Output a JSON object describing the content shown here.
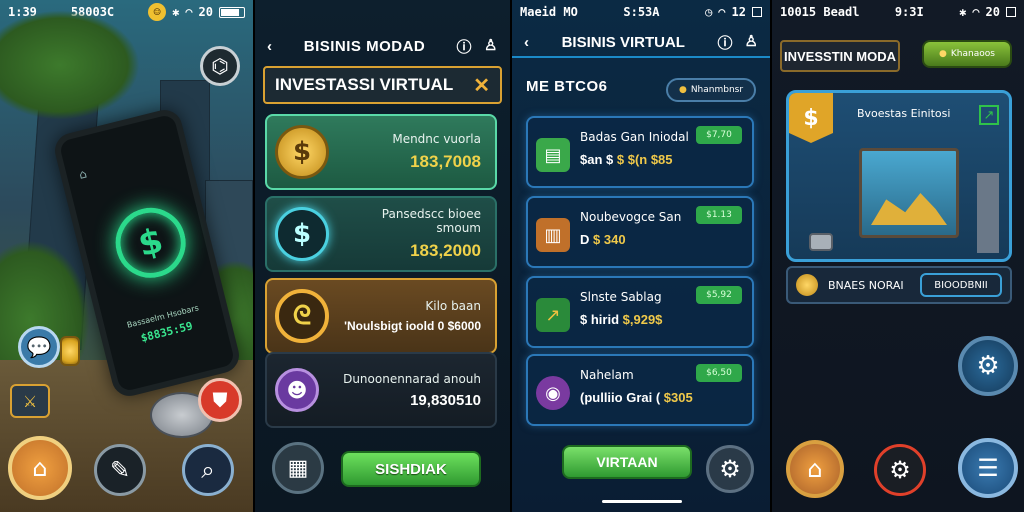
{
  "panel1": {
    "status": {
      "time": "1:39",
      "carrier": "58003C",
      "battery": "20"
    },
    "phone_screen": {
      "line1": "Bassaelm Hsobars",
      "amount": "$8835:59"
    },
    "icons": {
      "top_right": "lock-icon",
      "home": "home-icon",
      "tools": "tools-icon",
      "search": "search-icon",
      "chat": "chat-icon",
      "sword": "sword-icon",
      "shield": "shield-icon"
    }
  },
  "panel2": {
    "header": {
      "title": "BISINIS MODAD"
    },
    "title_box": {
      "label": "INVESTASSI VIRTUAL"
    },
    "cards": [
      {
        "name": "Mendnc vuorla",
        "value": "183,7008"
      },
      {
        "name": "Pansedscc bioee smoum",
        "value": "183,2000"
      },
      {
        "name": "Kilo baan",
        "value": "'Noulsbigt ioold 0 $6000"
      },
      {
        "name": "Dunoonennarad anouh",
        "value": "19,830510"
      }
    ],
    "main_button": "SISHDIAK"
  },
  "panel3": {
    "status": {
      "carrier": "Maeid",
      "network": "MO",
      "clock": "S:53A",
      "battery": "12"
    },
    "header": {
      "title": "BISINIS VIRTUAL"
    },
    "subtitle": "ME BTCO6",
    "pill": "Nhanmbnsr",
    "cards": [
      {
        "name": "Badas Gan Iniodal",
        "value_prefix": "$an $",
        "value": "$ $(n $85",
        "tag": "$7,70"
      },
      {
        "name": "Noubevogce San",
        "value_prefix": "D",
        "value": "$ 340",
        "tag": "$1.13"
      },
      {
        "name": "Slnste Sablag",
        "value_prefix": "$ hirid",
        "value": "$,929$",
        "tag": "$5,92"
      },
      {
        "name": "Nahelam",
        "value_prefix": "(pulliio Grai (",
        "value": "$305",
        "tag": "$6,50"
      }
    ],
    "main_button": "VIRTAAN"
  },
  "panel4": {
    "status": {
      "time": "10015",
      "carrier": "Beadl",
      "clock": "9:3I",
      "battery": "20"
    },
    "title_box": {
      "label": "INVESSTIN MODA"
    },
    "top_button": "Khanaoos",
    "card_label": "Bvoestas Einitosi",
    "strip": {
      "label": "BNAES NORAI",
      "button": "BIOODBNII"
    }
  }
}
